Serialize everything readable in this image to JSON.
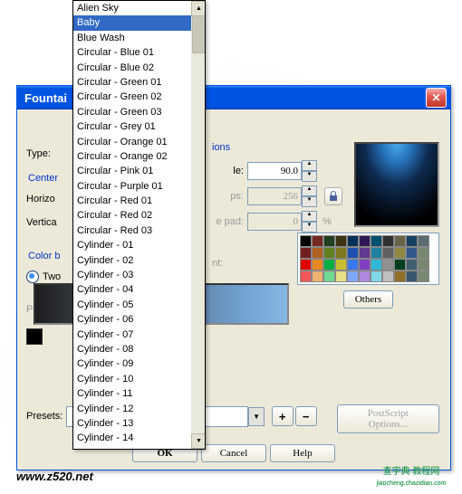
{
  "window": {
    "title_visible": "Fountai",
    "close": "✕"
  },
  "options_label": "ions",
  "type": {
    "label": "Type:"
  },
  "center": {
    "label": "Center"
  },
  "horizontal": {
    "label": "Horizo"
  },
  "vertical": {
    "label": "Vertica"
  },
  "options": {
    "angle": {
      "label": "le:",
      "value": "90.0"
    },
    "steps": {
      "label": "ps:",
      "value": "256"
    },
    "edgepad": {
      "label": "e pad:",
      "value": "0",
      "unit": "%"
    }
  },
  "colorblend": {
    "label": "Color b"
  },
  "twocolor": {
    "label": "Two"
  },
  "position": {
    "label": "Positio"
  },
  "right_label": "nt:",
  "others": "Others",
  "presets": {
    "label": "Presets:",
    "value": ""
  },
  "postscript": "PostScript Options...",
  "buttons": {
    "ok": "OK",
    "cancel": "Cancel",
    "help": "Help"
  },
  "dropdown": {
    "selected_index": 1,
    "items": [
      "Alien Sky",
      "Baby",
      "Blue Wash",
      "Circular - Blue 01",
      "Circular - Blue 02",
      "Circular - Green 01",
      "Circular - Green 02",
      "Circular - Green 03",
      "Circular - Grey 01",
      "Circular - Orange 01",
      "Circular - Orange 02",
      "Circular - Pink 01",
      "Circular - Purple 01",
      "Circular - Red 01",
      "Circular - Red 02",
      "Circular - Red 03",
      "Cylinder - 01",
      "Cylinder - 02",
      "Cylinder - 03",
      "Cylinder - 04",
      "Cylinder - 05",
      "Cylinder - 06",
      "Cylinder - 07",
      "Cylinder - 08",
      "Cylinder - 09",
      "Cylinder - 10",
      "Cylinder - 11",
      "Cylinder - 12",
      "Cylinder - 13",
      "Cylinder - 14"
    ]
  },
  "palette": [
    "#000000",
    "#752820",
    "#204020",
    "#3C3410",
    "#003058",
    "#301858",
    "#005070",
    "#303030",
    "#6C6448",
    "#184060",
    "#5C6C70",
    "#702020",
    "#B06020",
    "#608020",
    "#807820",
    "#2050B0",
    "#603890",
    "#2080A0",
    "#606060",
    "#908840",
    "#305888",
    "#788870",
    "#E00000",
    "#E88820",
    "#00B040",
    "#C8C030",
    "#3878F0",
    "#8040C0",
    "#30B8D8",
    "#909090",
    "#004020",
    "#406070",
    "#788870",
    "#F05858",
    "#F0B070",
    "#70D890",
    "#E8E088",
    "#80A8F8",
    "#B088E0",
    "#80D8E8",
    "#C0C0C0",
    "#907028",
    "#38586C",
    "#788870"
  ],
  "watermarks": {
    "left": "www.z520.net",
    "right_top": "查字典  教程网",
    "right_bottom": "jiaocheng.chazidian.com"
  }
}
